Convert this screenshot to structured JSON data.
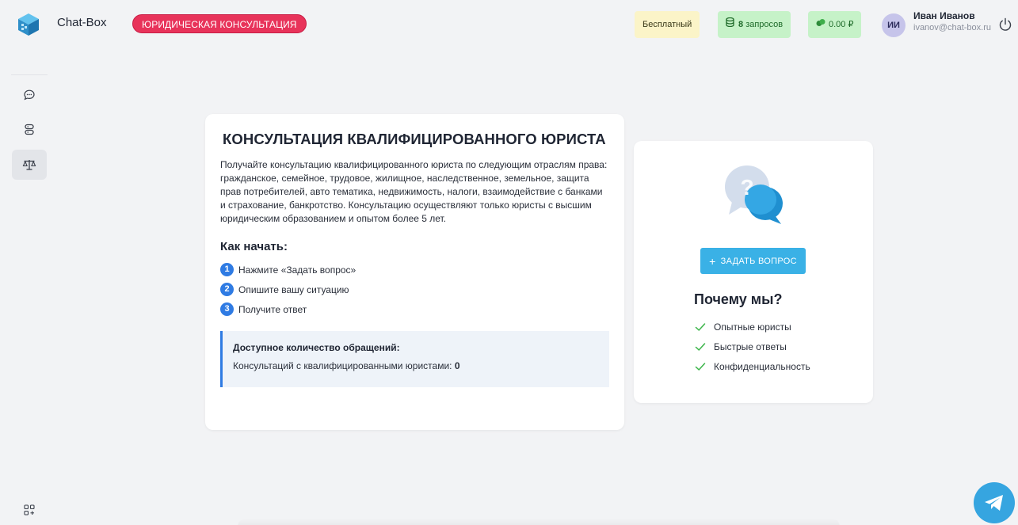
{
  "header": {
    "brand": "Chat-Box",
    "mode_badge": "ЮРИДИЧЕСКАЯ КОНСУЛЬТАЦИЯ",
    "plan": "Бесплатный",
    "requests_count": "8",
    "requests_label": "запросов",
    "balance": "0.00 ₽",
    "user": {
      "initials": "ИИ",
      "name": "Иван Иванов",
      "email": "ivanov@chat-box.ru"
    }
  },
  "sidebar": {
    "items": [
      {
        "icon": "chat-bubble-icon",
        "active": false
      },
      {
        "icon": "database-icon",
        "active": false
      },
      {
        "icon": "scales-icon",
        "active": true
      }
    ],
    "bottom_icon": "apps-add-icon"
  },
  "main": {
    "title": "КОНСУЛЬТАЦИЯ КВАЛИФИЦИРОВАННОГО ЮРИСТА",
    "intro": "Получайте консультацию квалифицированного юриста по следующим отраслям права: гражданское, семейное, трудовое, жилищное, наследственное, земельное, защита прав потребителей, авто тематика, недвижимость, налоги, взаимодействие с банками и страхование, банкротство. Консультацию осуществляют только юристы с высшим юридическим образованием и опытом более 5 лет.",
    "how_title": "Как начать:",
    "steps": [
      {
        "num": "1",
        "text": "Нажмите «Задать вопрос»"
      },
      {
        "num": "2",
        "text": "Опишите вашу ситуацию"
      },
      {
        "num": "3",
        "text": "Получите ответ"
      }
    ],
    "quota": {
      "title": "Доступное количество обращений:",
      "label": "Консультаций с квалифицированными юристами:",
      "value": "0"
    }
  },
  "side": {
    "ask_button": "ЗАДАТЬ ВОПРОС",
    "ask_icon": "+",
    "why_title": "Почему мы?",
    "benefits": [
      "Опытные юристы",
      "Быстрые ответы",
      "Конфиденциальность"
    ]
  },
  "colors": {
    "accent": "#3ab1e6",
    "badge": "#e8335a",
    "step": "#2f7be3",
    "success": "#3cb54a"
  }
}
